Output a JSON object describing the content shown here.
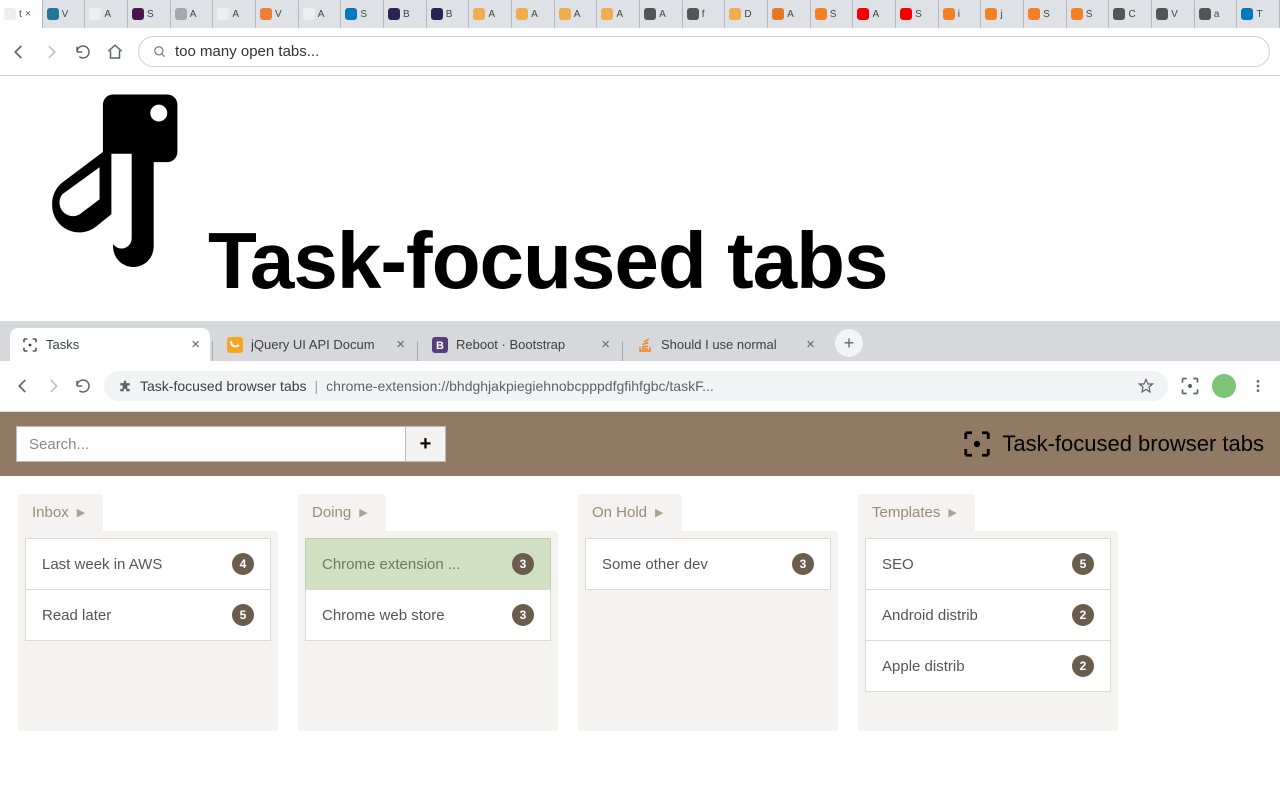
{
  "top_browser": {
    "omnibox_text": "too many open tabs...",
    "tabs": [
      {
        "label": "t",
        "ico": "#eee",
        "active": true,
        "closable": true
      },
      {
        "label": "V",
        "ico": "#21759b"
      },
      {
        "label": "A",
        "ico": "#eee"
      },
      {
        "label": "S",
        "ico": "#4a154b"
      },
      {
        "label": "A",
        "ico": "#a2aaad"
      },
      {
        "label": "A",
        "ico": "#eee"
      },
      {
        "label": "V",
        "ico": "#ee7e33"
      },
      {
        "label": "A",
        "ico": "#eee"
      },
      {
        "label": "S",
        "ico": "#0079bf"
      },
      {
        "label": "B",
        "ico": "#2c2255"
      },
      {
        "label": "B",
        "ico": "#2c2255"
      },
      {
        "label": "A",
        "ico": "#f0ad4e"
      },
      {
        "label": "A",
        "ico": "#f0ad4e"
      },
      {
        "label": "A",
        "ico": "#f0ad4e"
      },
      {
        "label": "A",
        "ico": "#f0ad4e"
      },
      {
        "label": "A",
        "ico": "#555"
      },
      {
        "label": "f",
        "ico": "#555"
      },
      {
        "label": "D",
        "ico": "#f0ad4e"
      },
      {
        "label": "A",
        "ico": "#e87722"
      },
      {
        "label": "S",
        "ico": "#f48024"
      },
      {
        "label": "A",
        "ico": "#f80000"
      },
      {
        "label": "S",
        "ico": "#f80000"
      },
      {
        "label": "i",
        "ico": "#f48024"
      },
      {
        "label": "j",
        "ico": "#f48024"
      },
      {
        "label": "S",
        "ico": "#f48024"
      },
      {
        "label": "S",
        "ico": "#f48024"
      },
      {
        "label": "C",
        "ico": "#555"
      },
      {
        "label": "V",
        "ico": "#555"
      },
      {
        "label": "a",
        "ico": "#555"
      },
      {
        "label": "T",
        "ico": "#0079bf"
      }
    ]
  },
  "hero_title": "Task-focused tabs",
  "second_browser": {
    "tabs": [
      {
        "label": "Tasks",
        "icon": "tasks",
        "active": true
      },
      {
        "label": "jQuery UI API Docum",
        "icon": "jquery"
      },
      {
        "label": "Reboot · Bootstrap",
        "icon": "bootstrap"
      },
      {
        "label": "Should I use normal",
        "icon": "so"
      }
    ],
    "omnibox_name": "Task-focused browser tabs",
    "omnibox_url": "chrome-extension://bhdghjakpiegiehnobcpppdfgfihfgbc/taskF..."
  },
  "extension": {
    "search_placeholder": "Search...",
    "title": "Task-focused browser tabs"
  },
  "columns": [
    {
      "title": "Inbox",
      "cards": [
        {
          "label": "Last week in AWS",
          "count": "4"
        },
        {
          "label": "Read later",
          "count": "5"
        }
      ]
    },
    {
      "title": "Doing",
      "cards": [
        {
          "label": "Chrome extension ...",
          "count": "3",
          "active": true
        },
        {
          "label": "Chrome web store",
          "count": "3"
        }
      ]
    },
    {
      "title": "On Hold",
      "cards": [
        {
          "label": "Some other dev",
          "count": "3"
        }
      ]
    },
    {
      "title": "Templates",
      "cards": [
        {
          "label": "SEO",
          "count": "5"
        },
        {
          "label": "Android distrib",
          "count": "2"
        },
        {
          "label": "Apple distrib",
          "count": "2"
        }
      ]
    }
  ]
}
